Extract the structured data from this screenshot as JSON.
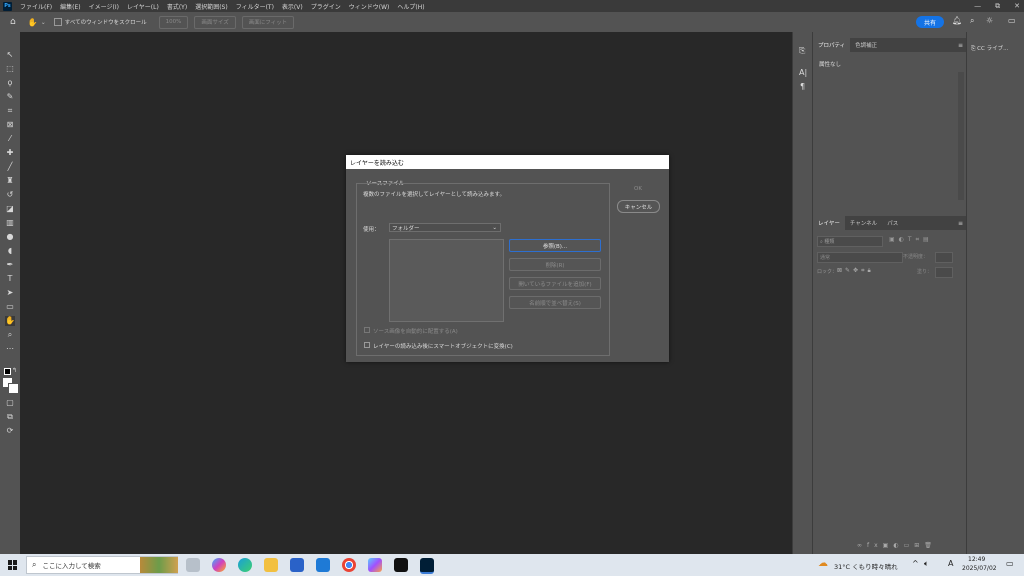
{
  "app": {
    "logo": "Ps"
  },
  "menubar": {
    "items": [
      "ファイル(F)",
      "編集(E)",
      "イメージ(I)",
      "レイヤー(L)",
      "書式(Y)",
      "選択範囲(S)",
      "フィルター(T)",
      "表示(V)",
      "プラグイン",
      "ウィンドウ(W)",
      "ヘルプ(H)"
    ],
    "window_controls": [
      "—",
      "⧉",
      "✕"
    ]
  },
  "optionsbar": {
    "scroll_all_label": "すべてのウィンドウをスクロール",
    "zoom_100": "100%",
    "fit_screen": "画面サイズ",
    "fill_screen": "画面にフィット",
    "share": "共有"
  },
  "panels": {
    "properties_tab": "プロパティ",
    "adjust_tab": "色調補正",
    "properties_empty": "属性なし",
    "layers_tab": "レイヤー",
    "channels_tab": "チャンネル",
    "paths_tab": "パス",
    "kind_label": "種類",
    "blend_mode": "通常",
    "opacity_label": "不透明度：",
    "lock_label": "ロック：",
    "fill_label": "塗り："
  },
  "cc_dock": {
    "label": "CC ライブ..."
  },
  "dialog": {
    "title": "レイヤーを読み込む",
    "group_label": "ソースファイル",
    "description": "複数のファイルを選択してレイヤーとして読み込みます。",
    "use_label": "使用：",
    "use_value": "フォルダー",
    "browse": "参照(B)...",
    "remove": "削除(R)",
    "add_open": "開いているファイルを追加(F)",
    "sort_name": "名前順で並べ替え(S)",
    "auto_align": "ソース画像を自動的に配置する(A)",
    "smart_object": "レイヤーの読み込み後にスマートオブジェクトに変換(C)",
    "ok": "OK",
    "cancel": "キャンセル"
  },
  "taskbar": {
    "search_placeholder": "ここに入力して検索",
    "weather": "31°C くもり時々晴れ",
    "ime": "A",
    "time": "12:49",
    "date": "2025/07/02"
  },
  "colors": {
    "accent": "#1473e6",
    "panel": "#535353",
    "canvas": "#282828"
  }
}
